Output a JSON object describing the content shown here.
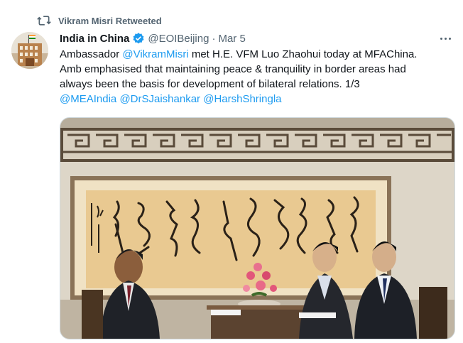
{
  "retweet": {
    "label": "Vikram Misri Retweeted",
    "icon": "retweet-icon"
  },
  "author": {
    "name": "India in China",
    "handle": "@EOIBeijing",
    "separator": "·",
    "date": "Mar 5",
    "verified": true,
    "avatar_icon": "building-flag-avatar"
  },
  "more": {
    "icon": "more-dots-icon"
  },
  "tweet": {
    "line1_pre": "Ambassador ",
    "mention1": "@VikramMisri",
    "line1_post": " met H.E. VFM Luo Zhaohui today at MFAChina.",
    "line2": "Amb emphasised that maintaining peace & tranquility in border areas had",
    "line3": "always been the basis for development of bilateral relations. 1/3",
    "mention2": "@MEAIndia",
    "mention3": "@DrSJaishankar",
    "mention4": "@HarshShringla"
  },
  "photo": {
    "description_icon": "meeting-photo"
  },
  "colors": {
    "accent": "#1d9bf0",
    "muted": "#536471",
    "text": "#0f1419"
  }
}
